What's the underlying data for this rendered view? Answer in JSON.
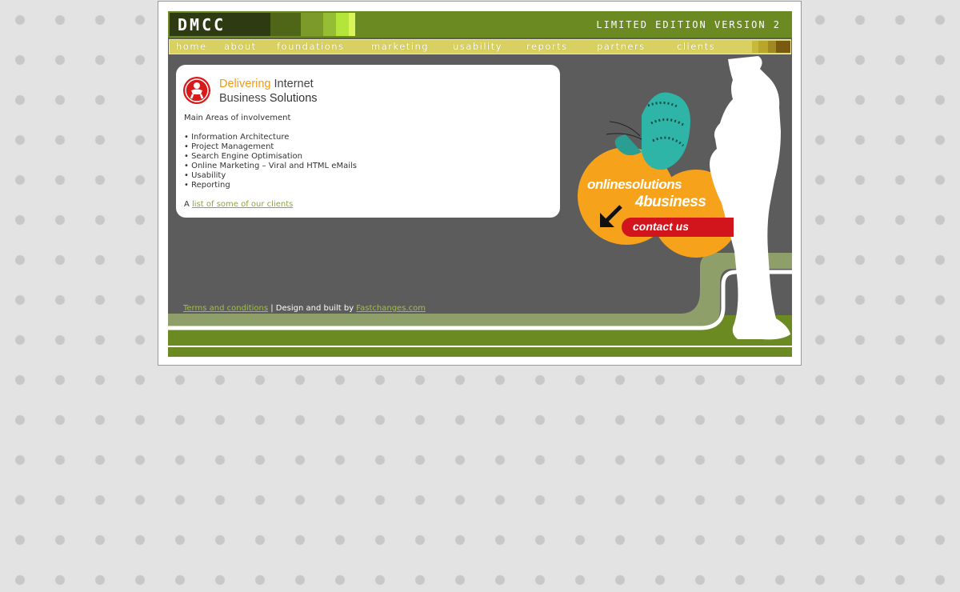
{
  "header": {
    "logo_text": "DMCC",
    "edition_text": "LIMITED EDITION VERSION 2"
  },
  "nav": {
    "items": [
      "home",
      "about",
      "foundations",
      "marketing",
      "usability",
      "reports",
      "partners",
      "clients"
    ]
  },
  "intro": {
    "title_line1_accent": "Delivering",
    "title_line1_rest": " Internet",
    "title_line2_plain": "Business ",
    "title_line2_bold": "Solutions",
    "areas_heading": "Main Areas of involvement",
    "services": [
      "• Information Architecture",
      "• Project Management",
      "• Search Engine Optimisation",
      "• Online Marketing – Viral and HTML eMails",
      "• Usability",
      "• Reporting"
    ],
    "clients_prefix": "A ",
    "clients_link": "list of some of our clients"
  },
  "promo": {
    "online_text": "onlinesolutions",
    "business_text": "4business",
    "contact_label": "contact us"
  },
  "footer": {
    "terms_link": "Terms and conditions",
    "separator": " | Design and built by ",
    "builder_link": "Fastchanges.com"
  },
  "colors": {
    "olive": "#6b8a21",
    "nav_yellow": "#d8d060",
    "orange": "#f7a21b",
    "red": "#d2151c",
    "panel_grey": "#5c5c5c"
  }
}
